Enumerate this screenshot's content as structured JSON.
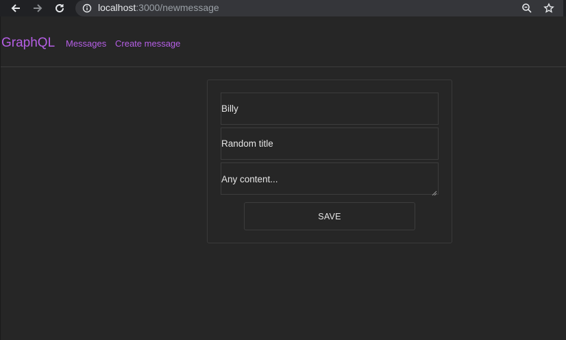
{
  "browser": {
    "url_host": "localhost",
    "url_rest": ":3000/newmessage",
    "icons": {
      "back": "back-arrow-icon",
      "forward": "forward-arrow-icon",
      "reload": "reload-icon",
      "info": "info-icon",
      "zoom": "zoom-out-icon",
      "bookmark": "star-icon"
    }
  },
  "navbar": {
    "brand": "GraphQL",
    "links": [
      {
        "label": "Messages"
      },
      {
        "label": "Create message"
      }
    ]
  },
  "form": {
    "author_value": "Billy",
    "title_value": "Random title",
    "content_value": "Any content...",
    "save_label": "SAVE"
  },
  "colors": {
    "background": "#262626",
    "accent": "#b65fe6",
    "border": "#3d3d3d",
    "text": "#e6e6e6"
  }
}
